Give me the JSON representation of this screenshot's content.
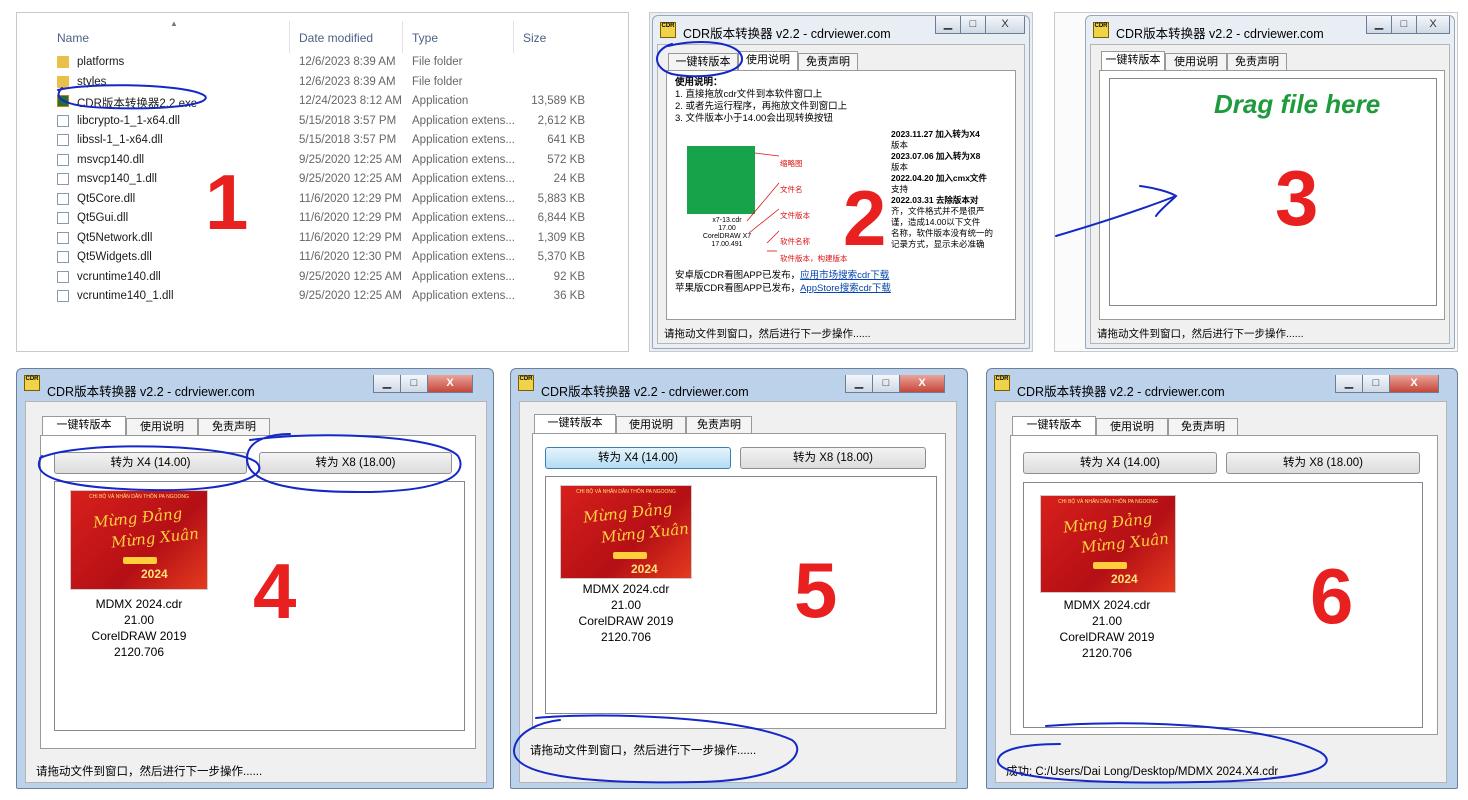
{
  "panel1": {
    "number": "1",
    "columns": {
      "name": "Name",
      "date": "Date modified",
      "type": "Type",
      "size": "Size"
    },
    "files": [
      {
        "name": "platforms",
        "date": "12/6/2023 8:39 AM",
        "type": "File folder",
        "size": "",
        "icon": "folder-icon"
      },
      {
        "name": "styles",
        "date": "12/6/2023 8:39 AM",
        "type": "File folder",
        "size": "",
        "icon": "folder-icon"
      },
      {
        "name": "CDR版本转换器2.2.exe",
        "date": "12/24/2023 8:12 AM",
        "type": "Application",
        "size": "13,589 KB",
        "icon": "app-icon"
      },
      {
        "name": "libcrypto-1_1-x64.dll",
        "date": "5/15/2018 3:57 PM",
        "type": "Application extens...",
        "size": "2,612 KB",
        "icon": "dll-icon"
      },
      {
        "name": "libssl-1_1-x64.dll",
        "date": "5/15/2018 3:57 PM",
        "type": "Application extens...",
        "size": "641 KB",
        "icon": "dll-icon"
      },
      {
        "name": "msvcp140.dll",
        "date": "9/25/2020 12:25 AM",
        "type": "Application extens...",
        "size": "572 KB",
        "icon": "dll-icon"
      },
      {
        "name": "msvcp140_1.dll",
        "date": "9/25/2020 12:25 AM",
        "type": "Application extens...",
        "size": "24 KB",
        "icon": "dll-icon"
      },
      {
        "name": "Qt5Core.dll",
        "date": "11/6/2020 12:29 PM",
        "type": "Application extens...",
        "size": "5,883 KB",
        "icon": "dll-icon"
      },
      {
        "name": "Qt5Gui.dll",
        "date": "11/6/2020 12:29 PM",
        "type": "Application extens...",
        "size": "6,844 KB",
        "icon": "dll-icon"
      },
      {
        "name": "Qt5Network.dll",
        "date": "11/6/2020 12:29 PM",
        "type": "Application extens...",
        "size": "1,309 KB",
        "icon": "dll-icon"
      },
      {
        "name": "Qt5Widgets.dll",
        "date": "11/6/2020 12:30 PM",
        "type": "Application extens...",
        "size": "5,370 KB",
        "icon": "dll-icon"
      },
      {
        "name": "vcruntime140.dll",
        "date": "9/25/2020 12:25 AM",
        "type": "Application extens...",
        "size": "92 KB",
        "icon": "dll-icon"
      },
      {
        "name": "vcruntime140_1.dll",
        "date": "9/25/2020 12:25 AM",
        "type": "Application extens...",
        "size": "36 KB",
        "icon": "dll-icon"
      }
    ]
  },
  "app": {
    "title": "CDR版本转换器 v2.2 - cdrviewer.com",
    "icon_text": "CDR",
    "tabs": [
      "一键转版本",
      "使用说明",
      "免责声明"
    ],
    "minimize": "▁",
    "maximize": "□",
    "close": "X",
    "btn_x4": "转为 X4 (14.00)",
    "btn_x8": "转为 X8 (18.00)",
    "status_default": "请拖动文件到窗口，然后进行下一步操作......",
    "status_success": "成功: C:/Users/Dai Long/Desktop/MDMX 2024.X4.cdr"
  },
  "panel2": {
    "number": "2",
    "instructions": [
      "使用说明：",
      "1. 直接拖放cdr文件到本软件窗口上",
      "2. 或者先运行程序，再拖放文件到窗口上",
      "3. 文件版本小于14.00会出现转换按钮"
    ],
    "changelog": [
      "2023.11.27 加入转为X4",
      "版本",
      "2023.07.06 加入转为X8",
      "版本",
      "2022.04.20 加入cmx文件",
      "支持",
      "2022.03.31 去除版本对",
      "齐，文件格式并不是很严",
      "谨，造成14.00以下文件",
      "名称，软件版本没有统一的",
      "记录方式，显示未必准确"
    ],
    "preview_labels": [
      "缩略图",
      "文件名",
      "文件版本",
      "软件名称",
      "软件版本，构建版本"
    ],
    "preview_texts": [
      "x7-13.cdr",
      "17.00",
      "CorelDRAW X7",
      "17.00.491"
    ],
    "links": [
      {
        "prefix": "安卓版CDR看图APP已发布，",
        "link": "应用市场搜索cdr下载"
      },
      {
        "prefix": "苹果版CDR看图APP已发布，",
        "link": "AppStore搜索cdr下载"
      }
    ]
  },
  "panel3": {
    "number": "3",
    "drag_text": "Drag file here"
  },
  "file_info": {
    "name": "MDMX 2024.cdr",
    "version": "21.00",
    "software": "CorelDRAW 2019",
    "build": "2120.706",
    "thumb_header": "CHI BỘ VÀ NHÂN DÂN THÔN PA NGOONG",
    "thumb_line1": "Mừng Đảng",
    "thumb_line2": "Mừng Xuân",
    "thumb_year": "2024"
  },
  "panel4": {
    "number": "4"
  },
  "panel5": {
    "number": "5"
  },
  "panel6": {
    "number": "6"
  },
  "colors": {
    "accent_red": "#e8201f",
    "drag_green": "#1f9a3c",
    "annotation_blue": "#1428c8",
    "link_blue": "#0645ad"
  }
}
